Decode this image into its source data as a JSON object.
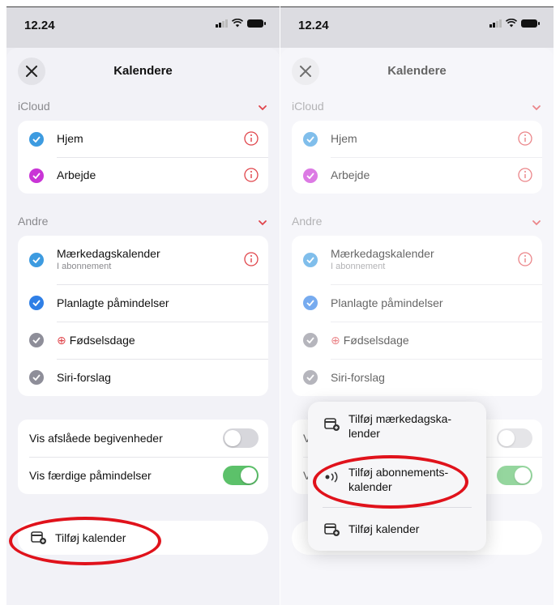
{
  "status_bar": {
    "time": "12.24"
  },
  "sheet": {
    "title": "Kalendere"
  },
  "icloud": {
    "header": "iCloud",
    "items": [
      {
        "label": "Hjem",
        "color": "#3d9be0"
      },
      {
        "label": "Arbejde",
        "color": "#c934d6"
      }
    ]
  },
  "other": {
    "header": "Andre",
    "items": [
      {
        "label": "Mærkedagskalender",
        "sub": "I abonnement",
        "color": "#3d9be0"
      },
      {
        "label": "Planlagte påmindelser",
        "color": "#2f7fe6"
      },
      {
        "label": "Fødselsdage",
        "color": "#8e8e99"
      },
      {
        "label": "Siri-forslag",
        "color": "#8e8e99"
      }
    ]
  },
  "toggles": [
    {
      "label": "Vis afslåede begivenheder",
      "state": "off"
    },
    {
      "label": "Vis færdige påmindelser",
      "state": "on",
      "color": "#5cc16a"
    }
  ],
  "add_calendar": {
    "label": "Tilføj kalender"
  },
  "menu": {
    "items": [
      {
        "label": "Tilføj mærkedagska-\nlender",
        "icon": "calendar-add-icon"
      },
      {
        "label": "Tilføj abonnements-\nkalender",
        "icon": "broadcast-icon"
      },
      {
        "label": "Tilføj kalender",
        "icon": "calendar-add-icon"
      }
    ]
  },
  "colors": {
    "accent_red": "#e0444a",
    "annotation": "#e0121b"
  }
}
